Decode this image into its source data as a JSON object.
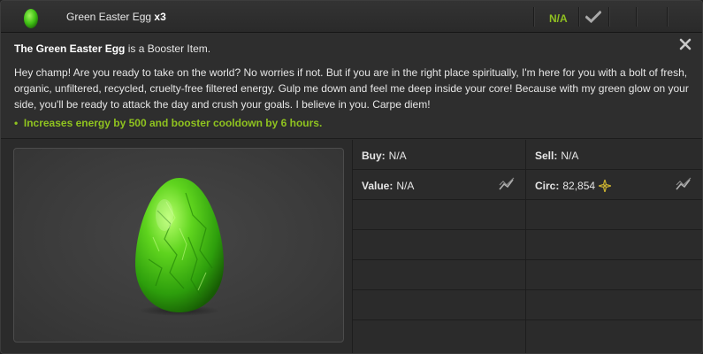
{
  "header": {
    "item_name": "Green Easter Egg",
    "quantity": "x3",
    "price": "N/A",
    "accent_color": "#8fbf21"
  },
  "description": {
    "item_title": "The Green Easter Egg",
    "item_type_text": " is a Booster Item.",
    "body": "Hey champ! Are you ready to take on the world? No worries if not. But if you are in the right place spiritually, I'm here for you with a bolt of fresh, organic, unfiltered, recycled, cruelty-free filtered energy. Gulp me down and feel me deep inside your core! Because with my green glow on your side, you'll be ready to attack the day and crush your goals. I believe in you. Carpe diem!",
    "effect": "Increases energy by 500 and booster cooldown by 6 hours."
  },
  "stats": {
    "buy_label": "Buy:",
    "buy_value": "N/A",
    "sell_label": "Sell:",
    "sell_value": "N/A",
    "value_label": "Value:",
    "value_value": "N/A",
    "circ_label": "Circ:",
    "circ_value": "82,854"
  },
  "icons": {
    "header_thumb": "green-egg-icon",
    "check": "checkmark-icon",
    "close": "close-icon",
    "graph": "line-graph-icon",
    "circ": "compass-star-icon"
  }
}
